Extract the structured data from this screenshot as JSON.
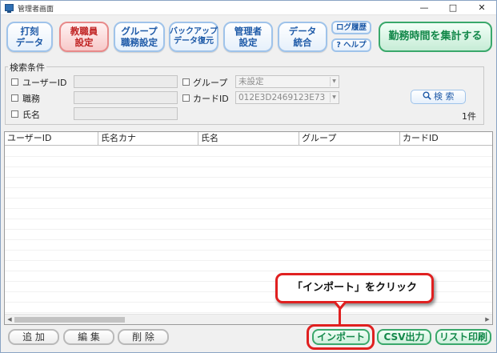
{
  "window": {
    "title": "管理者画面",
    "minimize_glyph": "—",
    "maximize_glyph": "□",
    "close_glyph": "✕"
  },
  "toolbar": {
    "buttons": [
      {
        "line1": "打刻",
        "line2": "データ"
      },
      {
        "line1": "教職員",
        "line2": "設定",
        "active": true
      },
      {
        "line1": "グループ",
        "line2": "職務設定"
      },
      {
        "line1": "バックアップ",
        "line2": "データ復元"
      },
      {
        "line1": "管理者",
        "line2": "設定"
      },
      {
        "line1": "データ",
        "line2": "統合"
      }
    ],
    "log_label": "ログ履歴",
    "help_label": "? ヘルプ",
    "aggregate_label": "勤務時間を集計する"
  },
  "search": {
    "legend": "検索条件",
    "user_id_label": "ユーザーID",
    "duty_label": "職務",
    "name_label": "氏名",
    "group_label": "グループ",
    "group_value": "未設定",
    "card_id_label": "カードID",
    "card_id_value": "012E3D2469123E73",
    "search_button_label": "検 索",
    "result_count": "1件"
  },
  "grid": {
    "columns": [
      "ユーザーID",
      "氏名カナ",
      "氏名",
      "グループ",
      "カードID"
    ]
  },
  "bottom": {
    "add_label": "追 加",
    "edit_label": "編 集",
    "delete_label": "削 除",
    "import_label": "インポート",
    "csv_label": "CSV出力",
    "print_label": "リスト印刷"
  },
  "annotation": {
    "text": "「インポート」をクリック",
    "color": "#e02020"
  },
  "icons": [
    "app-icon",
    "minimize-icon",
    "maximize-icon",
    "close-icon",
    "search-icon",
    "checkbox-icon",
    "dropdown-arrow-icon"
  ]
}
